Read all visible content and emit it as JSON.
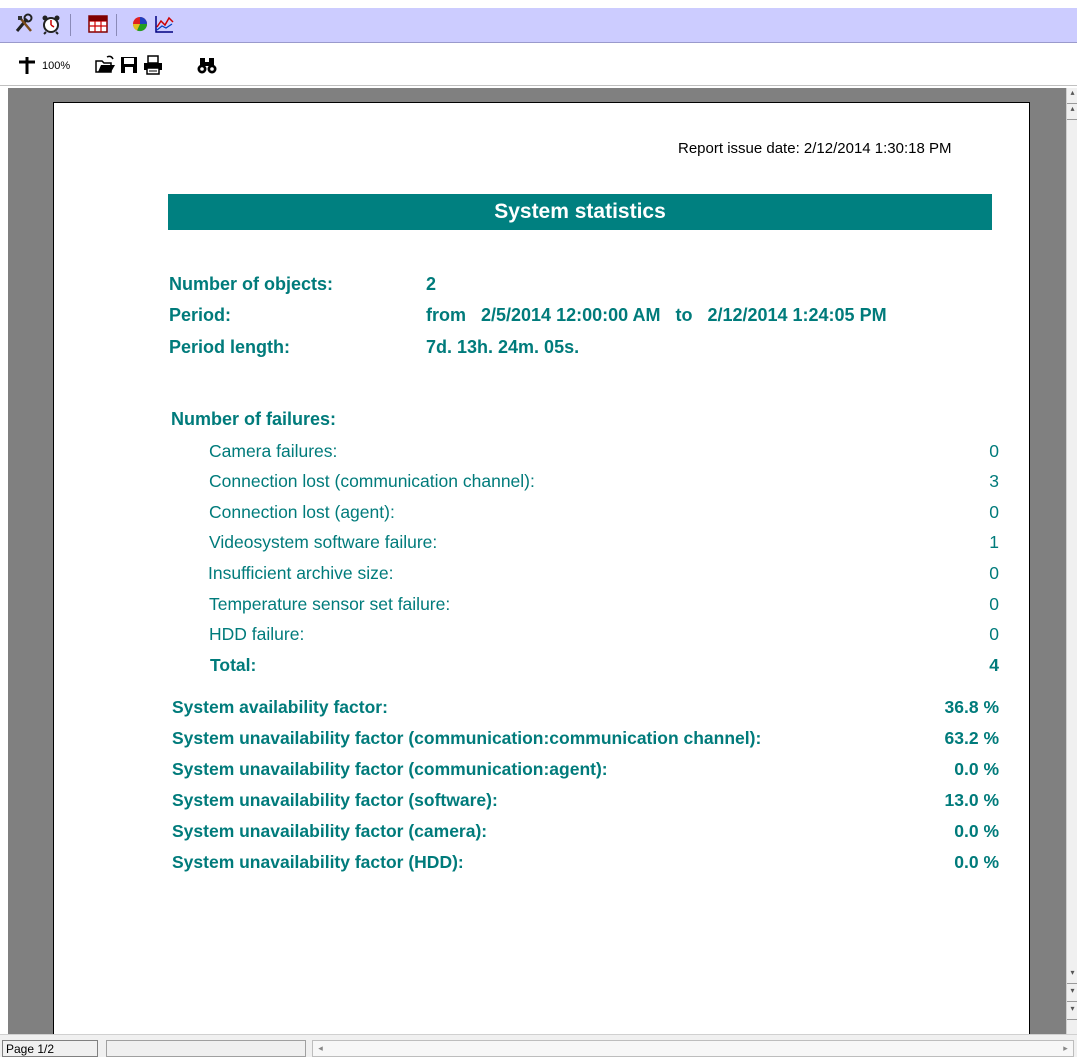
{
  "toolbar_top": {
    "icons": [
      "tools-icon",
      "alarm-clock-icon",
      "table-report-icon",
      "pie-chart-icon",
      "line-chart-icon"
    ]
  },
  "toolbar_report": {
    "zoom_label": "100%",
    "icons": [
      "zoom-cross-icon",
      "open-folder-icon",
      "save-disk-icon",
      "print-icon",
      "binoculars-icon"
    ]
  },
  "report": {
    "issue_date": "Report issue date: 2/12/2014 1:30:18 PM",
    "title": "System statistics",
    "summary": [
      {
        "label": "Number of objects:",
        "value": "2"
      },
      {
        "label": "Period:",
        "value": "from   2/5/2014 12:00:00 AM   to   2/12/2014 1:24:05 PM"
      },
      {
        "label": "Period length:",
        "value": "7d. 13h. 24m. 05s."
      }
    ],
    "failures_heading": "Number of failures:",
    "failures": [
      {
        "label": "Camera failures:",
        "value": "0"
      },
      {
        "label": "Connection lost (communication channel):",
        "value": "3"
      },
      {
        "label": "Connection lost (agent):",
        "value": "0"
      },
      {
        "label": "Videosystem software failure:",
        "value": "1"
      },
      {
        "label": "Insufficient archive size:",
        "value": "0"
      },
      {
        "label": "Temperature sensor set failure:",
        "value": "0"
      },
      {
        "label": "HDD failure:",
        "value": "0"
      }
    ],
    "total_label": "Total:",
    "total_value": "4",
    "factors": [
      {
        "label": "System availability factor:",
        "value": "36.8 %"
      },
      {
        "label": "System unavailability factor (communication:communication channel):",
        "value": "63.2 %"
      },
      {
        "label": "System unavailability factor (communication:agent):",
        "value": "0.0 %"
      },
      {
        "label": "System unavailability factor (software):",
        "value": "13.0 %"
      },
      {
        "label": "System unavailability factor (camera):",
        "value": "0.0 %"
      },
      {
        "label": "System unavailability factor (HDD):",
        "value": "0.0 %"
      }
    ]
  },
  "status": {
    "page": "Page 1/2"
  },
  "colors": {
    "accent": "#008080",
    "text": "#007b7b",
    "toolbar": "#ccccff"
  }
}
